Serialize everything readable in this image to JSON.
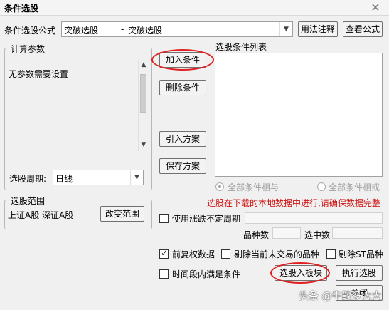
{
  "window": {
    "title": "条件选股"
  },
  "formula": {
    "label": "条件选股公式",
    "selected_code": "突破选股",
    "separator": "-",
    "selected_name": "突破选股",
    "usage_button": "用法注释",
    "view_button": "查看公式"
  },
  "params": {
    "legend": "计算参数",
    "text": "无参数需要设置"
  },
  "actions": {
    "add_condition": "加入条件",
    "delete_condition": "删除条件",
    "import_plan": "引入方案",
    "save_plan": "保存方案"
  },
  "condition_list": {
    "label": "选股条件列表",
    "radio_and": "全部条件相与",
    "radio_or": "全部条件相或"
  },
  "period": {
    "label": "选股周期:",
    "value": "日线"
  },
  "scope": {
    "legend": "选股范围",
    "markets": "上证A股  深证A股",
    "change_button": "改变范围"
  },
  "notice": "选股在下载的本地数据中进行,请确保数据完整",
  "options": {
    "variable_period": "使用涨跌不定周期",
    "variety_count_label": "品种数",
    "selected_count_label": "选中数",
    "pre_adjust": "前复权数据",
    "exclude_suspended": "剔除当前未交易的品种",
    "exclude_st": "剔除ST品种",
    "time_range": "时间段内满足条件"
  },
  "bottom": {
    "to_block_button": "选股入板块",
    "execute_button": "执行选股",
    "close_button": "关闭"
  },
  "watermark": "头条 @牛散多大大",
  "colors": {
    "highlight_circle": "#e02020",
    "notice_text": "#d01010"
  }
}
